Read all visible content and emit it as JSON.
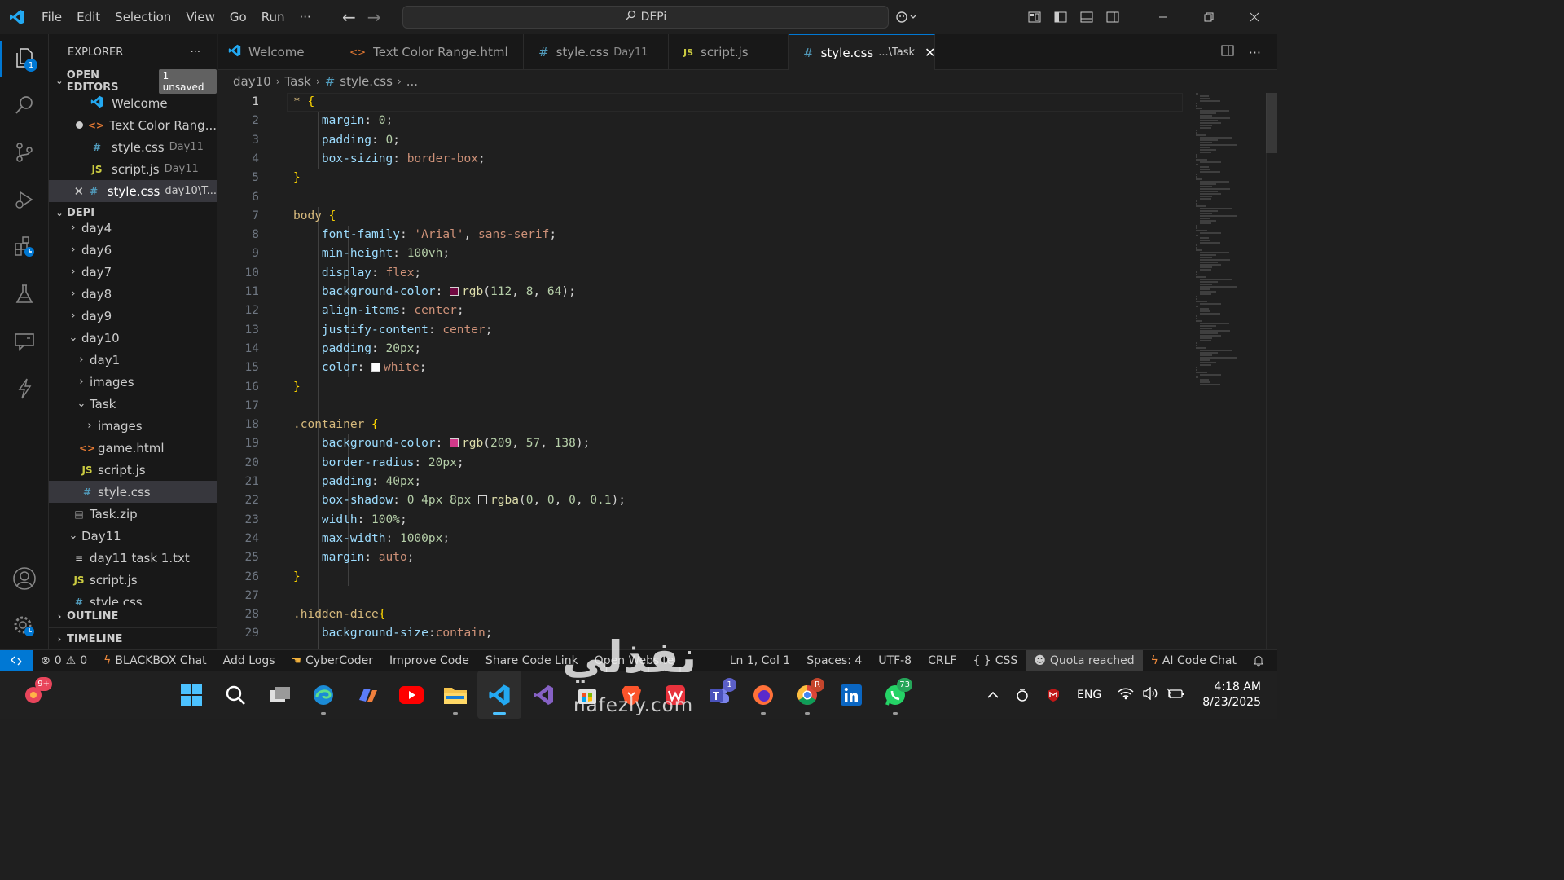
{
  "titlebar": {
    "menu": [
      "File",
      "Edit",
      "Selection",
      "View",
      "Go",
      "Run",
      "···"
    ],
    "search_text": "DEPi"
  },
  "activity": {
    "explorer_badge": "1"
  },
  "sidebar": {
    "title": "EXPLORER",
    "more": "···",
    "open_editors": {
      "label": "OPEN EDITORS",
      "badge": "1 unsaved",
      "items": [
        {
          "name": "Welcome",
          "desc": ""
        },
        {
          "name": "Text Color Rang...",
          "desc": ""
        },
        {
          "name": "style.css",
          "desc": "Day11"
        },
        {
          "name": "script.js",
          "desc": "Day11"
        },
        {
          "name": "style.css",
          "desc": "day10\\T..."
        }
      ]
    },
    "workspace": {
      "label": "DEPI",
      "tree": [
        "day4",
        "day6",
        "day7",
        "day8",
        "day9",
        "day10",
        "day1",
        "images",
        "Task",
        "images",
        "game.html",
        "script.js",
        "style.css",
        "Task.zip",
        "Day11",
        "day11 task 1.txt",
        "script.js",
        "style.css"
      ]
    },
    "outline_label": "OUTLINE",
    "timeline_label": "TIMELINE"
  },
  "tabs": [
    {
      "label": "Welcome",
      "desc": ""
    },
    {
      "label": "Text Color Range.html",
      "desc": ""
    },
    {
      "label": "style.css",
      "desc": "Day11"
    },
    {
      "label": "script.js",
      "desc": ""
    },
    {
      "label": "style.css",
      "desc": "...\\Task"
    }
  ],
  "breadcrumb": [
    "day10",
    "Task",
    "style.css",
    "..."
  ],
  "editor": {
    "line_numbers": [
      "1",
      "2",
      "3",
      "4",
      "5",
      "6",
      "7",
      "8",
      "9",
      "10",
      "11",
      "12",
      "13",
      "14",
      "15",
      "16",
      "17",
      "18",
      "19",
      "20",
      "21",
      "22",
      "23",
      "24",
      "25",
      "26",
      "27",
      "28",
      "29"
    ],
    "lines": [
      "* {",
      "    margin: 0;",
      "    padding: 0;",
      "    box-sizing: border-box;",
      "}",
      "",
      "body {",
      "    font-family: 'Arial', sans-serif;",
      "    min-height: 100vh;",
      "    display: flex;",
      "    background-color: rgb(112, 8, 64);",
      "    align-items: center;",
      "    justify-content: center;",
      "    padding: 20px;",
      "    color: white;",
      "}",
      "",
      ".container {",
      "    background-color: rgb(209, 57, 138);",
      "    border-radius: 20px;",
      "    padding: 40px;",
      "    box-shadow: 0 4px 8px rgba(0, 0, 0, 0.1);",
      "    width: 100%;",
      "    max-width: 1000px;",
      "    margin: auto;",
      "}",
      "",
      ".hidden-dice{",
      "    background-size:contain;"
    ],
    "swatches": {
      "body_bg": "#700840",
      "body_color": "#ffffff",
      "container_bg": "#d1398a",
      "shadow": "#1f1f1f"
    }
  },
  "statusbar": {
    "errors": "0",
    "warnings": "0",
    "left_items": [
      "BLACKBOX Chat",
      "Add Logs",
      "CyberCoder",
      "Improve Code",
      "Share Code Link",
      "Open Website"
    ],
    "position": "Ln 1, Col 1",
    "spaces": "Spaces: 4",
    "encoding": "UTF-8",
    "eol": "CRLF",
    "language": "CSS",
    "quota": "Quota reached",
    "ai_chat": "AI Code Chat"
  },
  "taskbar": {
    "copilot_badge": "9+",
    "teams_badge": "1",
    "chrome_badge": "R",
    "whatsapp_badge": "73",
    "lang": "ENG",
    "time": "4:18 AM",
    "date": "8/23/2025"
  },
  "watermark": {
    "brand": "نفذلي",
    "url": "nafezly.com"
  },
  "colors": {
    "accent": "#0078d4",
    "editor_bg": "#1f1f1f",
    "sidebar_bg": "#181818"
  }
}
